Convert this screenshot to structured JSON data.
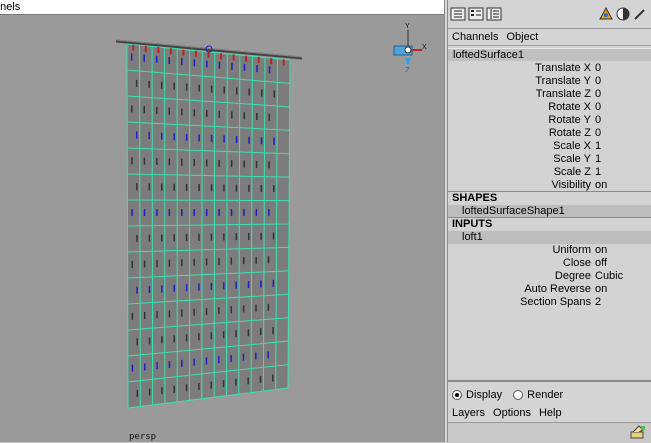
{
  "viewport": {
    "title_partial": "nnels",
    "camera_label": "persp",
    "axis_labels": {
      "y": "Y",
      "z": "Z",
      "x": "X"
    }
  },
  "channel_box": {
    "toolbar_icons": [
      "channel-box-icon",
      "attribute-editor-icon",
      "layer-editor-icon",
      "tool-settings-icon",
      "render-icon",
      "pin-icon"
    ],
    "menu": {
      "channels": "Channels",
      "object": "Object"
    },
    "object_name": "loftedSurface1",
    "transform_attrs": [
      {
        "label": "Translate X",
        "value": "0"
      },
      {
        "label": "Translate Y",
        "value": "0"
      },
      {
        "label": "Translate Z",
        "value": "0"
      },
      {
        "label": "Rotate X",
        "value": "0"
      },
      {
        "label": "Rotate Y",
        "value": "0"
      },
      {
        "label": "Rotate Z",
        "value": "0"
      },
      {
        "label": "Scale X",
        "value": "1"
      },
      {
        "label": "Scale Y",
        "value": "1"
      },
      {
        "label": "Scale Z",
        "value": "1"
      },
      {
        "label": "Visibility",
        "value": "on"
      }
    ],
    "shapes_header": "SHAPES",
    "shape_name": "loftedSurfaceShape1",
    "inputs_header": "INPUTS",
    "input_name": "loft1",
    "input_attrs": [
      {
        "label": "Uniform",
        "value": "on"
      },
      {
        "label": "Close",
        "value": "off"
      },
      {
        "label": "Degree",
        "value": "Cubic"
      },
      {
        "label": "Auto Reverse",
        "value": "on"
      },
      {
        "label": "Section Spans",
        "value": "2"
      }
    ]
  },
  "layer_editor": {
    "display_label": "Display",
    "render_label": "Render",
    "selected_mode": "Display",
    "menu": {
      "layers": "Layers",
      "options": "Options",
      "help": "Help"
    }
  },
  "colors": {
    "viewport_bg": "#9a9a9a",
    "mesh_fill": "#7c7c7c",
    "wire": "#3de0b0",
    "accent_blue": "#2020c0",
    "accent_red": "#c02020"
  }
}
